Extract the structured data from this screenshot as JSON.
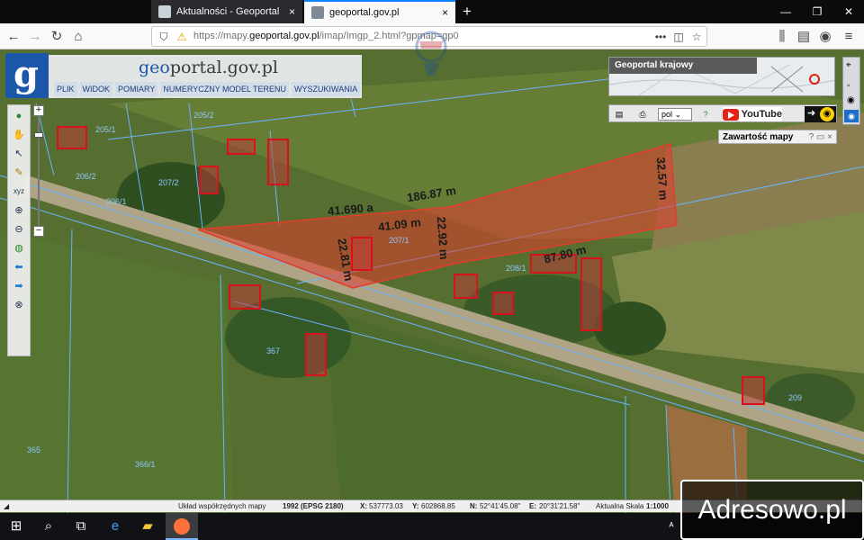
{
  "browser": {
    "tabs": [
      {
        "title": "Aktualności - Geoportal Krajowy",
        "close": "×"
      },
      {
        "title": "geoportal.gov.pl",
        "close": "×"
      }
    ],
    "new_tab": "+",
    "url_prefix": "https://mapy.",
    "url_domain": "geoportal.gov.pl",
    "url_path": "/imap/Imgp_2.html?gpmap=gp0",
    "url_menu": "•••"
  },
  "portal": {
    "logo_letter": "g",
    "title_geo": "geo",
    "title_rest": "portal.gov.pl",
    "menu": [
      "PLIK",
      "WIDOK",
      "POMIARY",
      "NUMERYCZNY MODEL TERENU",
      "WYSZUKIWANIA"
    ],
    "krajowy_title": "Geoportal krajowy",
    "lang": "pol",
    "youtube": "YouTube",
    "zawartosc": "Zawartość mapy",
    "zawartosc_icons": "? ▭ ×"
  },
  "measurements": {
    "area": "41.690 a",
    "side_top": "186.87 m",
    "side_right": "32.57 m",
    "side_inner": "41.09 m",
    "side_mid": "22.92 m",
    "side_left": "22.81 m",
    "side_bottom": "87.80 m"
  },
  "parcels": [
    "205/2",
    "205/1",
    "206/2",
    "206/1",
    "207/2",
    "207/1",
    "208/1",
    "367",
    "365",
    "366/1",
    "209"
  ],
  "statusbar": {
    "system_label": "Układ współrzędnych mapy",
    "system": "1992 (EPSG 2180)",
    "x_label": "X:",
    "x": "537773.03",
    "y_label": "Y:",
    "y": "602868.85",
    "n_label": "N:",
    "n": "52°41'45.08\"",
    "e_label": "E:",
    "e": "20°31'21.58\"",
    "scale_label": "Aktualna Skala",
    "scale": "1:1000"
  },
  "watermark": "Adresowo.pl",
  "colors": {
    "plot_fill": "#e23c2b",
    "building_outline": "#d8121a",
    "parcel_line": "#6ab4ff",
    "portal_blue": "#1c56a8"
  }
}
